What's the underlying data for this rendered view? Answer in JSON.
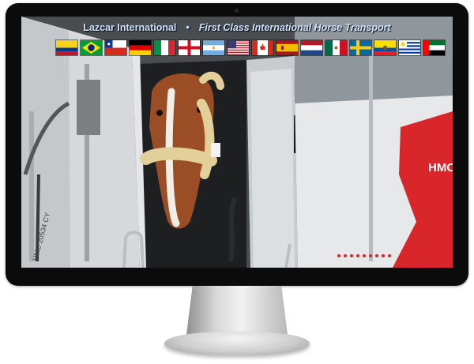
{
  "site": {
    "brand": "Lazcar International",
    "separator": "•",
    "tagline": "First Class International Horse Transport"
  },
  "flags": [
    "colombia-flag",
    "brazil-flag",
    "chile-flag",
    "germany-flag",
    "italy-flag",
    "england-flag",
    "argentina-flag",
    "usa-flag",
    "canada-flag",
    "spain-flag",
    "netherlands-flag",
    "mexico-flag",
    "sweden-flag",
    "ecuador-flag",
    "uruguay-flag",
    "uae-flag"
  ],
  "photo": {
    "icon": "horse-in-transport-truck-photo",
    "truck_text_right": "HMC",
    "truck_text_left": "HMC 20534 CY"
  },
  "colors": {
    "bezel": "#0b0b0b",
    "banner_text": "#cfe3ff",
    "truck_red": "#d8262b"
  }
}
